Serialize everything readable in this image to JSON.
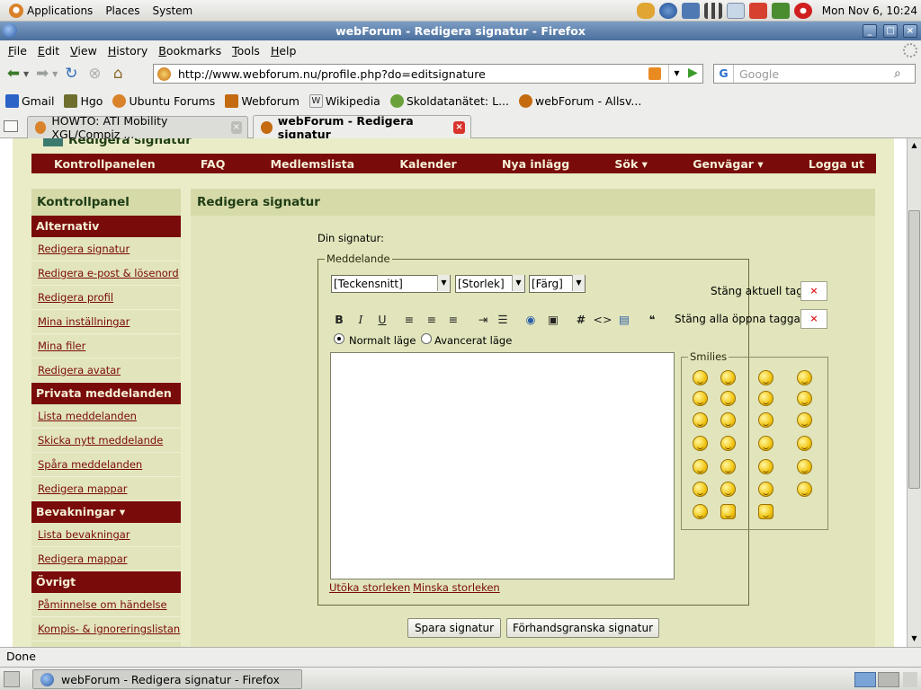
{
  "panel": {
    "applications": "Applications",
    "places": "Places",
    "system": "System",
    "clock": "Mon Nov  6, 10:24"
  },
  "window": {
    "title": "webForum - Redigera signatur - Firefox"
  },
  "menubar": [
    "File",
    "Edit",
    "View",
    "History",
    "Bookmarks",
    "Tools",
    "Help"
  ],
  "toolbar": {
    "url": "http://www.webforum.nu/profile.php?do=editsignature",
    "search_placeholder": "Google"
  },
  "bookmarks": [
    "Gmail",
    "Hgo",
    "Ubuntu Forums",
    "Webforum",
    "Wikipedia",
    "Skoldatanätet: L...",
    "webForum - Allsv..."
  ],
  "tabs": [
    {
      "label": "HOWTO: ATI Mobility XGL/Compiz ...",
      "active": false
    },
    {
      "label": "webForum - Redigera signatur",
      "active": true
    }
  ],
  "page": {
    "breadcrumb_title": "Redigera signatur",
    "nav": [
      "Kontrollpanelen",
      "FAQ",
      "Medlemslista",
      "Kalender",
      "Nya inlägg",
      "Sök ▾",
      "Genvägar ▾",
      "Logga ut"
    ],
    "sidebar": {
      "title": "Kontrollpanel",
      "sections": [
        {
          "heading": "Alternativ",
          "links": [
            "Redigera signatur",
            "Redigera e-post & lösenord",
            "Redigera profil",
            "Mina inställningar",
            "Mina filer",
            "Redigera avatar"
          ]
        },
        {
          "heading": "Privata meddelanden ▾",
          "links": [
            "Lista meddelanden",
            "Skicka nytt meddelande",
            "Spåra meddelanden",
            "Redigera mappar"
          ]
        },
        {
          "heading": "Bevakningar ▾",
          "links": [
            "Lista bevakningar",
            "Redigera mappar"
          ]
        },
        {
          "heading": "Övrigt",
          "links": [
            "Påminnelse om händelse",
            "Kompis- & ignoreringslistan"
          ]
        }
      ]
    },
    "main": {
      "title": "Redigera signatur",
      "signature_label": "Din signatur:",
      "fieldset_legend": "Meddelande",
      "font_select": "[Teckensnitt]",
      "size_select": "[Storlek]",
      "color_select": "[Färg]",
      "close_current_tag": "Stäng aktuell tag",
      "close_all_tags": "Stäng alla öppna taggar",
      "close_symbol": "×",
      "mode_normal": "Normalt läge",
      "mode_advanced": "Avancerat läge",
      "textarea_value": "",
      "smilies_legend": "Smilies",
      "increase_size": "Utöka storleken",
      "decrease_size": "Minska storleken",
      "save_button": "Spara signatur",
      "preview_button": "Förhandsgranska signatur"
    }
  },
  "statusbar": {
    "text": "Done"
  },
  "taskbar": {
    "window_button": "webForum - Redigera signatur - Firefox"
  }
}
